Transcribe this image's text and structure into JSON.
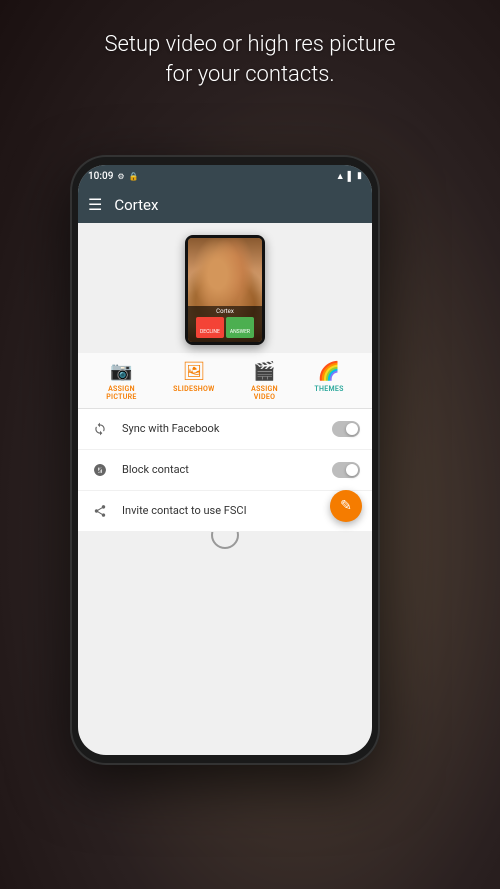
{
  "background": {
    "color_start": "#5a4a3a",
    "color_end": "#1a1010"
  },
  "headline": {
    "line1": "Setup video or high res picture",
    "line2": "for your contacts."
  },
  "status_bar": {
    "time": "10:09",
    "icons": [
      "settings",
      "lock",
      "wifi",
      "signal",
      "battery"
    ]
  },
  "toolbar": {
    "menu_icon": "☰",
    "title": "Cortex"
  },
  "mini_phone": {
    "caller_name": "Cortex",
    "btn_decline": "DECLINE",
    "btn_accept": "ANSWER"
  },
  "actions": [
    {
      "id": "assign-picture",
      "label": "ASSIGN\nPICTURE",
      "icon": "📷",
      "color": "orange"
    },
    {
      "id": "slideshow",
      "label": "SLIDESHOW",
      "icon": "🖼",
      "color": "orange"
    },
    {
      "id": "assign-video",
      "label": "ASSIGN\nVIDEO",
      "icon": "🎬",
      "color": "orange"
    },
    {
      "id": "themes",
      "label": "THEMES",
      "icon": "🌈",
      "color": "teal"
    }
  ],
  "settings_items": [
    {
      "id": "sync-facebook",
      "icon": "sync",
      "text": "Sync with Facebook",
      "has_toggle": true
    },
    {
      "id": "block-contact",
      "icon": "block",
      "text": "Block contact",
      "has_toggle": true
    },
    {
      "id": "invite-contact",
      "icon": "share",
      "text": "Invite contact to use FSCI",
      "has_toggle": false
    }
  ],
  "fab": {
    "icon": "✎",
    "color": "#f57c00"
  }
}
